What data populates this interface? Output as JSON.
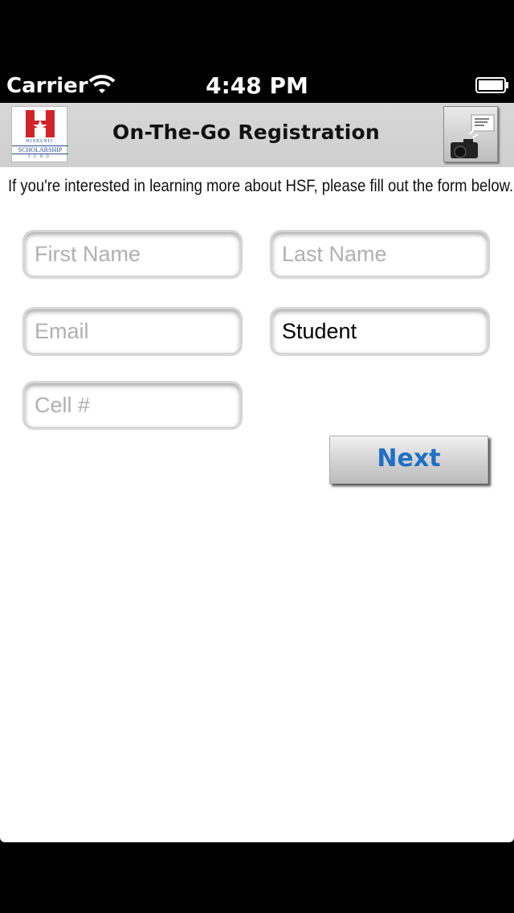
{
  "status_bar": {
    "carrier": "Carrier",
    "time": "4:48 PM",
    "wifi_icon": "wifi-icon",
    "battery_icon": "battery-icon"
  },
  "nav_bar": {
    "title": "On-The-Go Registration",
    "logo": {
      "letter": "H",
      "text_line1": "HISPANIC",
      "text_line2": "SCHOLARSHIP",
      "text_line3": "FUND"
    },
    "camera_icon": "camera-icon"
  },
  "intro_text": "If you're interested in learning more about HSF, please fill out the form below.",
  "form": {
    "first_name": {
      "placeholder": "First Name",
      "value": ""
    },
    "last_name": {
      "placeholder": "Last Name",
      "value": ""
    },
    "email": {
      "placeholder": "Email",
      "value": ""
    },
    "role": {
      "placeholder": "",
      "value": "Student"
    },
    "cell": {
      "placeholder": "Cell #",
      "value": ""
    }
  },
  "next_button_label": "Next",
  "colors": {
    "nav_bar_bg": "#d0d0d0",
    "next_label": "#1f6fc6",
    "logo_red": "#d2232a",
    "logo_blue": "#2a4a8f"
  }
}
